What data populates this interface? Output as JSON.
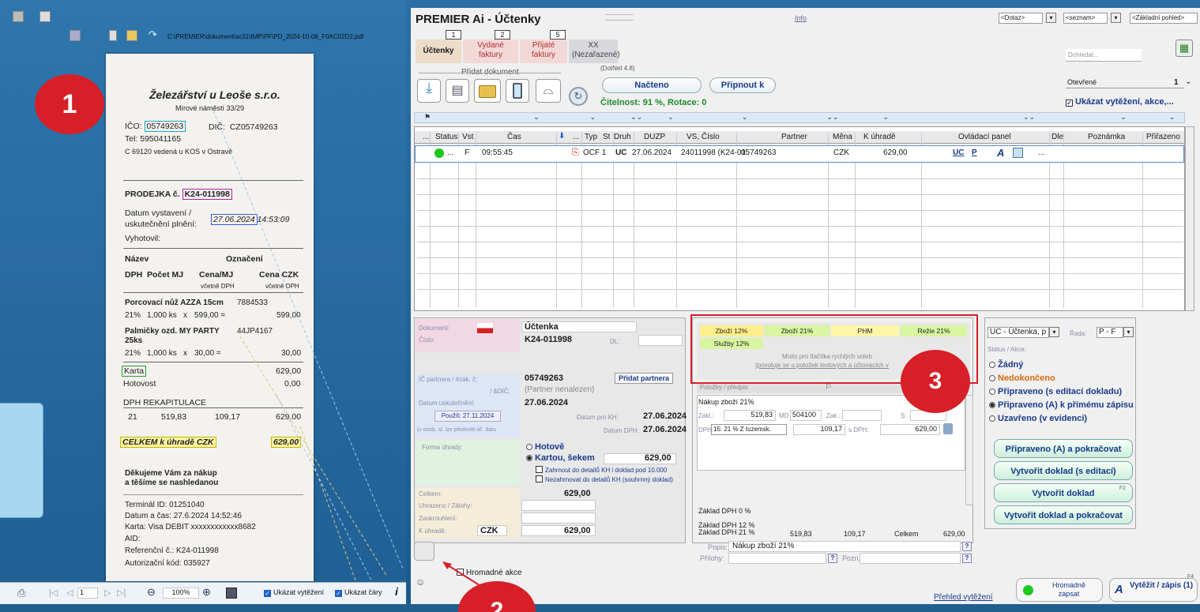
{
  "pdf_viewer": {
    "file_path": "C:\\PREMIER\\dokument\\sc31\\IMP\\PF\\PD_2024-10-08_F0AC02D2.pdf",
    "zoom": "100%",
    "page": "1",
    "show_extraction_label": "Ukázat vytěžení",
    "show_lines_label": "Ukázat čáry"
  },
  "receipt": {
    "company": "Železářství u Leoše s.r.o.",
    "address": "Mírové náměstí 33/29",
    "ico_label": "IČO:",
    "ico": "05749263",
    "dic_label": "DIČ:",
    "dic": "CZ05749263",
    "tel": "Tel:  595041165",
    "registry": "C 69120 vedená u KOS v Ostravě",
    "sale_label": "PRODEJKA č.",
    "sale_no": "K24-011998",
    "date_label_1": "Datum vystavení /",
    "date_label_2": "uskutečnění plnění:",
    "date": "27.06.2024",
    "time": "14:53:09",
    "issued_by": "Vyhotovil:",
    "col_name": "Název",
    "col_code": "Označení",
    "col_vat": "DPH",
    "col_qty": "Počet MJ",
    "col_price": "Cena/MJ",
    "col_total": "Cena CZK",
    "incl_vat_1": "včetně DPH",
    "incl_vat_2": "včetně DPH",
    "item1_name": "Porcovací nůž AZZA 15cm",
    "item1_code": "7884533",
    "item1_vat": "21%",
    "item1_qty": "1,000 ks",
    "item1_x": "x",
    "item1_price": "599,00 =",
    "item1_total": "599,00",
    "item2_name": "Palmičky ozd. MY PARTY",
    "item2_code": "44JP4167",
    "item2_name2": "25ks",
    "item2_vat": "21%",
    "item2_qty": "1,000 ks",
    "item2_x": "x",
    "item2_price": "30,00 =",
    "item2_total": "30,00",
    "card_label": "Karta",
    "card_value": "629,00",
    "cash_label": "Hotovost",
    "cash_value": "0,00",
    "vat_recap": "DPH REKAPITULACE",
    "recap_rate": "21",
    "recap_base": "519,83",
    "recap_vat": "109,17",
    "recap_total": "629,00",
    "total_label": "CELKEM k úhradě CZK",
    "total_value": "629,00",
    "thanks_1": "Děkujeme Vám za nákup",
    "thanks_2": "a těšíme se nashledanou",
    "terminal": "Terminál ID: 01251040",
    "datetime": "Datum a čas: 27.6.2024 14:52:46",
    "card": "Karta:  Visa DEBIT xxxxxxxxxxxx8682",
    "aid": "AID:",
    "ref": "Referenční č.: K24-011998",
    "auth": "Autorizační kód: 035927"
  },
  "annotations": {
    "n1": "1",
    "n2": "2",
    "n3": "3"
  },
  "app": {
    "title": "PREMIER Ai - Účtenky",
    "info": "Info",
    "query_dd": "<Dotaz>",
    "list_dd": "<seznam>",
    "view_dd": "<Základní pohled>",
    "search_placeholder": "Dohledat...",
    "tabs": [
      {
        "num": "1",
        "label": "Účtenky"
      },
      {
        "num": "2",
        "label": "Vydané faktury"
      },
      {
        "num": "5",
        "label": "Přijaté faktury"
      },
      {
        "num": "",
        "label": "XX (Nezařazené)"
      }
    ],
    "add_doc": "Přidat dokument",
    "dotnet": "(DotNet 4.8)",
    "loaded_btn": "Načteno",
    "attach_btn": "Připnout k",
    "readability": "Čitelnost: 91 %, Rotace:  0",
    "opened_dd": "Otevřené",
    "opened_count": "1",
    "show_extraction": "Ukázat vytěžení, akce,...",
    "grid_headers": [
      "...",
      "Status",
      "Vst",
      "Čas",
      "",
      "...",
      "Typ",
      "St",
      "Druh",
      "DUZP",
      "VS, Číslo",
      "Partner",
      "Měna",
      "K úhradě",
      "Ovládací panel",
      "Dle",
      "Poznámka",
      "Přiřazeno"
    ],
    "row": {
      "vst": "F",
      "time": "09:55:45",
      "typ": "OCF 1",
      "druh": "UC",
      "duzp": "27.06.2024",
      "vs": "24011998 (K24-01",
      "partner": "05749263",
      "currency": "CZK",
      "amount": "629,00",
      "ctrl_uc": "UC",
      "ctrl_p": "P",
      "dots": "...",
      "ellipsis": "..."
    }
  },
  "detail": {
    "doc_label": "Dokument:",
    "doc_value": "Účtenka",
    "num_label": "Číslo:",
    "num_value": "K24-011998",
    "dl_label": "DL:",
    "ic_label": "IČ partnera / #zák. č:",
    "ic_value": "05749263",
    "add_partner": "Přidat partnera",
    "dic_label": "/ &DIČ:",
    "partner_status": "(Partner nenalezen)",
    "date_label": "Datum uskutečnění:",
    "date_value": "27.06.2024",
    "use_date": "Použít: 27.11.2024",
    "kh_label": "Datum pro KH:",
    "kh_value": "27.06.2024",
    "dph_label": "Datum DPH:",
    "dph_value": "27.06.2024",
    "note_small": "(v osob. sl. lze předvolit úč. datu",
    "payment_label": "Forma úhrady:",
    "pay_cash": "Hotově",
    "pay_card": "Kartou, šekem",
    "pay_amount": "629,00",
    "chk_kh": "Zahrnout do detailů KH i doklad pod 10.000",
    "chk_no_kh": "Nezahrnovat do detailů KH (souhrnný doklad)",
    "total_label": "Celkem:",
    "total_value": "629,00",
    "paid_label": "Uhrazeno / Zálohy:",
    "round_label": "Zaokrouhlení:",
    "due_label": "K úhradě:",
    "due_cur": "CZK",
    "due_value": "629,00"
  },
  "quick": {
    "b1": "Zboží 12%",
    "b2": "Zboží 21%",
    "b3": "PHM",
    "b4": "Režie 21%",
    "b5": "Služby 12%",
    "hint1": "Místo pro tlačítka rychlých voleb",
    "hint2": "(povoluje se u položek textových a účtovacích v"
  },
  "items": {
    "header": "Položky / předpis",
    "name": "Nákup zboží 21%",
    "zakl_label": "Zákl.:",
    "zakl": "519,83",
    "md_label": "MD",
    "md": "504100",
    "zak_label": "Zak.:",
    "s_label": "S:",
    "dph_label": "DPH:",
    "dph_sel": "15: 21 % Z tuzemsk.",
    "dph_val": "109,17",
    "sdph_label": "s DPH:",
    "sdph": "629,00",
    "base0": "Základ DPH 0 %",
    "base12": "Základ DPH 12 %",
    "base21": "Základ DPH 21 %",
    "b21_base": "519,83",
    "b21_vat": "109,17",
    "celkem": "Celkem",
    "b21_total": "629,00",
    "popis_label": "Popis:",
    "popis": "Nákup zboží 21%",
    "prilohy_label": "Přílohy:",
    "pozn_label": "Pozn.:",
    "q": "?"
  },
  "right": {
    "type_dd": "UC - Účtenka, p",
    "rada_label": "Řada:",
    "rada": "P   - F",
    "status_label": "Status / Akce:",
    "r1": "Žádný",
    "r2": "Nedokončeno",
    "r3": "Připraveno (s editací dokladu)",
    "r4": "Připraveno (A) k přímému zápisu",
    "r5": "Uzavřeno (v evidenci)",
    "btn1": "Připraveno (A) a pokračovat",
    "btn2": "Vytvořit doklad (s editací)",
    "btn3": "Vytvořit doklad",
    "btn3_key": "F2",
    "btn4": "Vytvořit doklad a pokračovat",
    "bulk_write": "Hromadně zapsat",
    "extract_write": "Vytěžit / zápis (1)",
    "f4": "F4",
    "overview": "Přehled vytěžení",
    "bulk_actions": "Hromadné akce"
  },
  "colors": {
    "accent_red": "#d71f27",
    "status_green": "#1ec81e",
    "quick_yellow": "#ffef8c",
    "quick_green": "#d8f5a0"
  }
}
